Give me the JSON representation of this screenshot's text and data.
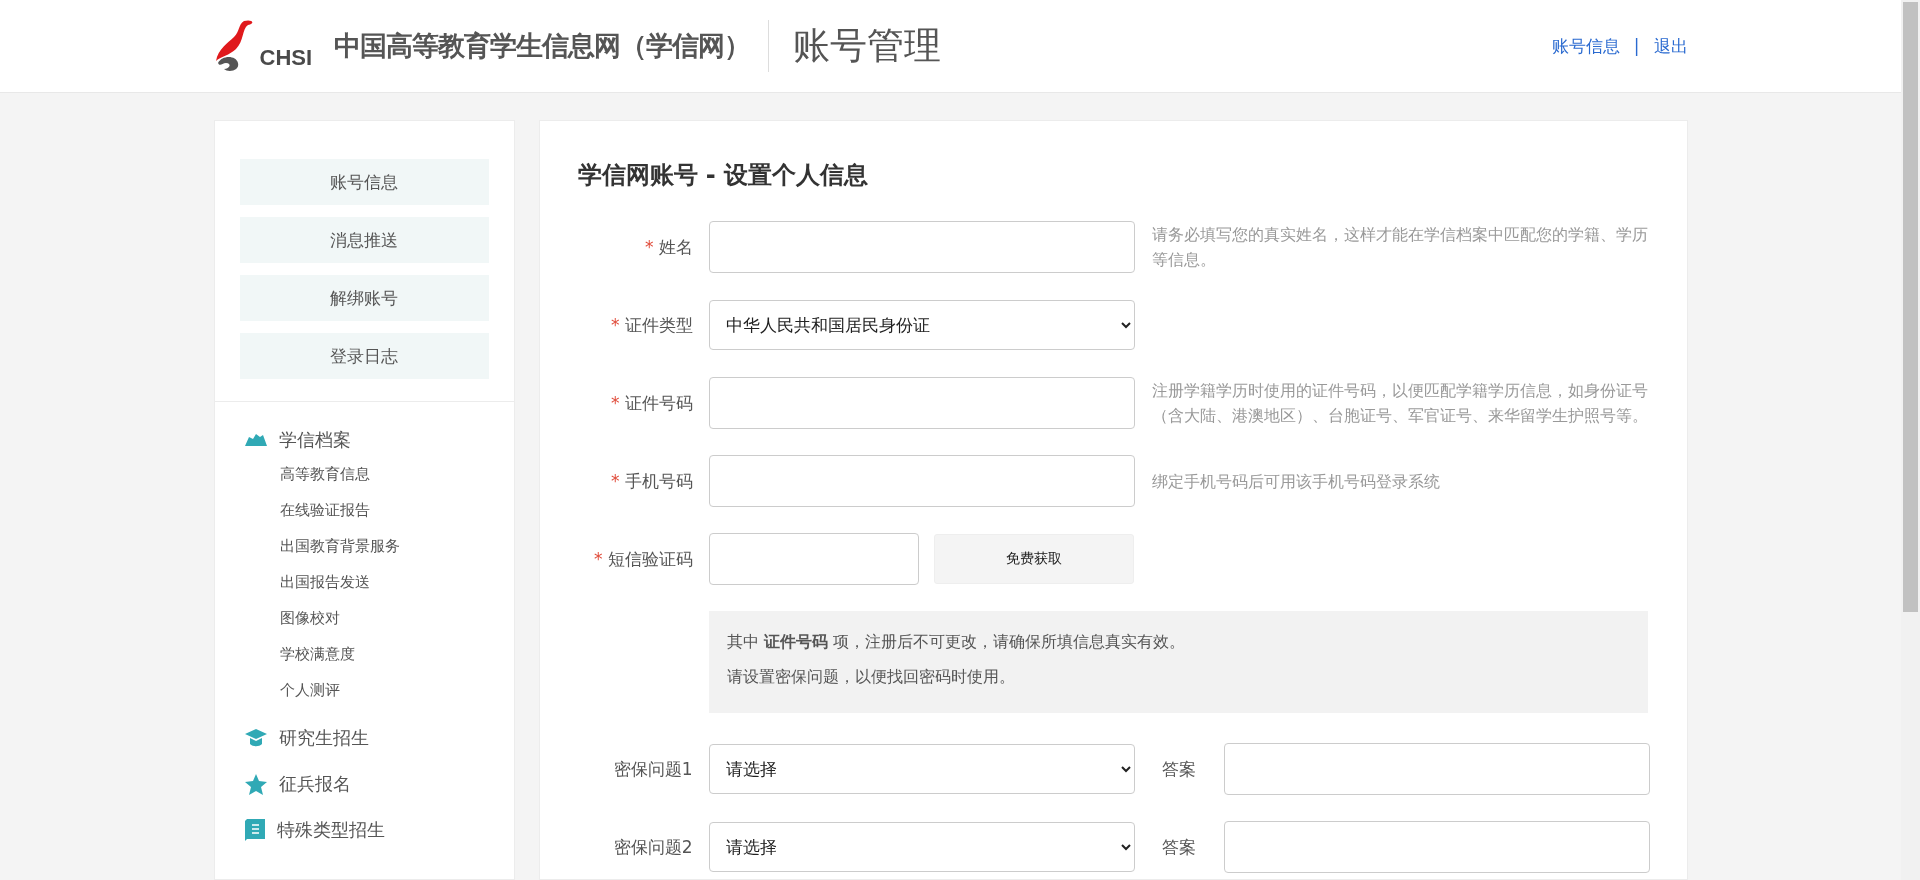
{
  "header": {
    "logo_text": "CHSI",
    "site_name": "中国高等教育学生信息网（学信网）",
    "section_title": "账号管理",
    "links": [
      "账号信息",
      "退出"
    ],
    "separator": "|"
  },
  "sidebar": {
    "buttons": [
      "账号信息",
      "消息推送",
      "解绑账号",
      "登录日志"
    ],
    "groups": [
      {
        "label": "学信档案",
        "items": [
          "高等教育信息",
          "在线验证报告",
          "出国教育背景服务",
          "出国报告发送",
          "图像校对",
          "学校满意度",
          "个人测评"
        ]
      },
      {
        "label": "研究生招生"
      },
      {
        "label": "征兵报名"
      },
      {
        "label": "特殊类型招生"
      }
    ]
  },
  "form": {
    "title": "学信网账号 - 设置个人信息",
    "fields": [
      {
        "kind": "text",
        "mark": "*",
        "label": "姓名",
        "hint": "请务必填写您的真实姓名，这样才能在学信档案中匹配您的学籍、学历等信息。"
      },
      {
        "kind": "select",
        "mark": "*",
        "label": "证件类型",
        "value": "中华人民共和国居民身份证"
      },
      {
        "kind": "text",
        "mark": "*",
        "label": "证件号码",
        "hint": "注册学籍学历时使用的证件号码，以便匹配学籍学历信息，如身份证号（含大陆、港澳地区）、台胞证号、军官证号、来华留学生护照号等。"
      },
      {
        "kind": "text",
        "mark": "*",
        "label": "手机号码",
        "hint": "绑定手机号码后可用该手机号码登录系统"
      },
      {
        "kind": "code",
        "mark": "*",
        "label": "短信验证码",
        "button": "免费获取"
      }
    ],
    "notice": [
      "其中 **证件号码** 项，注册后不可更改，请确保所填信息真实有效。",
      "请设置密保问题，以便找回密码时使用。"
    ],
    "security": [
      {
        "label": "密保问题1",
        "value": "请选择",
        "answer_label": "答案"
      },
      {
        "label": "密保问题2",
        "value": "请选择",
        "answer_label": "答案"
      }
    ]
  }
}
